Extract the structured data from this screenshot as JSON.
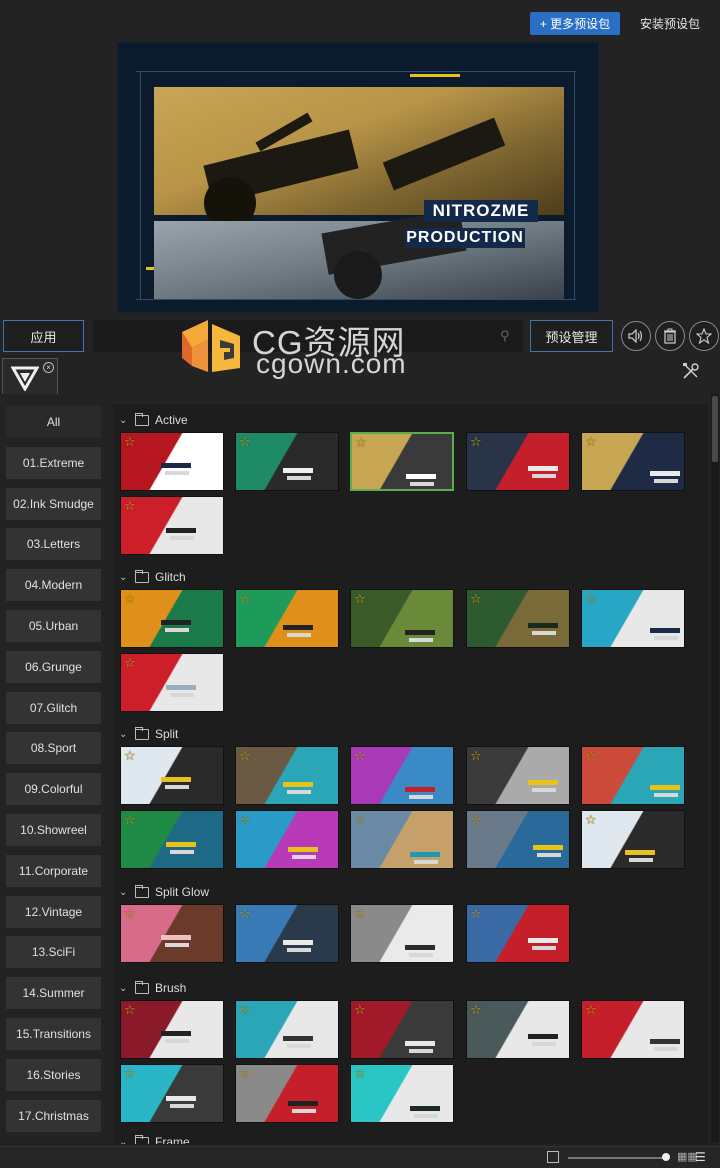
{
  "topbar": {
    "more_presets": "+ 更多预设包",
    "install_preset": "安装预设包"
  },
  "preview": {
    "title_line1": "NITROZME",
    "title_line2": "PRODUCTION"
  },
  "toolbar": {
    "apply": "应用",
    "search_placeholder": "",
    "preset_manage": "预设管理",
    "icons": [
      "search-icon",
      "speaker-icon",
      "trash-icon",
      "star-icon",
      "tools-icon"
    ]
  },
  "watermark": {
    "line1": "CG资源网",
    "line2": "cgown.com"
  },
  "categories": [
    "All",
    "01.Extreme",
    "02.Ink Smudge",
    "03.Letters",
    "04.Modern",
    "05.Urban",
    "06.Grunge",
    "07.Glitch",
    "08.Sport",
    "09.Colorful",
    "10.Showreel",
    "11.Corporate",
    "12.Vintage",
    "13.SciFi",
    "14.Summer",
    "15.Transitions",
    "16.Stories",
    "17.Christmas"
  ],
  "sections": [
    {
      "name": "Active",
      "count": 6
    },
    {
      "name": "Glitch",
      "count": 6
    },
    {
      "name": "Split",
      "count": 10
    },
    {
      "name": "Split Glow",
      "count": 4
    },
    {
      "name": "Brush",
      "count": 8
    },
    {
      "name": "Frame",
      "count": 0
    }
  ],
  "colors": {
    "accent_blue": "#2b6fc4",
    "selected_green": "#5cae4a",
    "star_gold": "#e6c21b"
  }
}
